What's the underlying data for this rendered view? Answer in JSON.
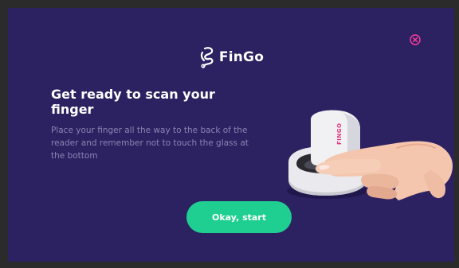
{
  "brand": {
    "name": "FinGo",
    "icon": "fingo-logo-icon"
  },
  "dialog": {
    "title": "Get ready to scan your finger",
    "instructions": "Place your finger all the way to the back of the reader and remember not to touch the glass at the bottom",
    "primary_button_label": "Okay, start",
    "close_icon": "close-circle-icon"
  },
  "device_label": "FINGO",
  "colors": {
    "background": "#2c2161",
    "accent": "#1fcf91",
    "close": "#ff3e9a",
    "body_text": "#8d85b2"
  }
}
